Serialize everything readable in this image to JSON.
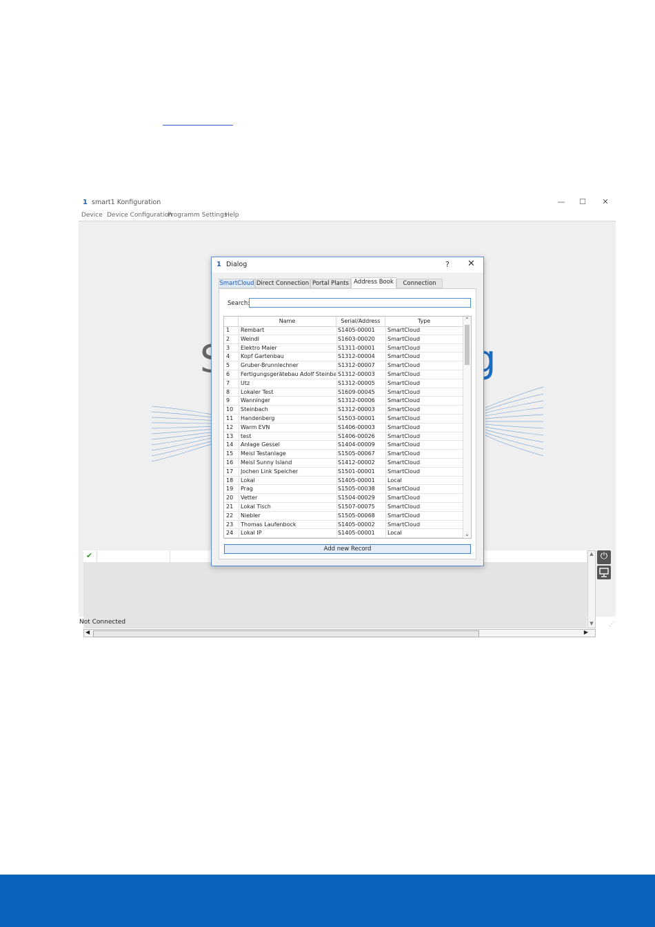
{
  "app": {
    "title": "smart1 Konfiguration",
    "logo_text": "1",
    "window_controls": {
      "minimize": "—",
      "maximize": "☐",
      "close": "✕"
    },
    "menu": [
      "Device",
      "Device Configuration",
      "Programm Settings",
      "Help"
    ],
    "status": "Not Connected",
    "background_fragments": {
      "left": "S",
      "right": "g"
    }
  },
  "dialog": {
    "title": "Dialog",
    "logo_text": "1",
    "help": "?",
    "close": "✕",
    "tabs": [
      "SmartCloud",
      "Direct Connection",
      "Portal Plants",
      "Address Book",
      "Connection Log"
    ],
    "selected_tab": "Address Book",
    "search": {
      "label": "Search:",
      "value": ""
    },
    "columns": [
      "Name",
      "Serial/Address",
      "Type"
    ],
    "rows": [
      {
        "n": "1",
        "name": "Rembart",
        "serial": "S1405-00001",
        "type": "SmartCloud"
      },
      {
        "n": "2",
        "name": "Weindl",
        "serial": "S1603-00020",
        "type": "SmartCloud"
      },
      {
        "n": "3",
        "name": "Elektro Maier",
        "serial": "S1311-00001",
        "type": "SmartCloud"
      },
      {
        "n": "4",
        "name": "Kopf Gartenbau",
        "serial": "S1312-00004",
        "type": "SmartCloud"
      },
      {
        "n": "5",
        "name": "Gruber-Brunnlechner",
        "serial": "S1312-00007",
        "type": "SmartCloud"
      },
      {
        "n": "6",
        "name": "Fertigungsgerätebau Adolf Steinba...",
        "serial": "S1312-00003",
        "type": "SmartCloud"
      },
      {
        "n": "7",
        "name": "Utz",
        "serial": "S1312-00005",
        "type": "SmartCloud"
      },
      {
        "n": "8",
        "name": "Lokaler Test",
        "serial": "S1609-00045",
        "type": "SmartCloud"
      },
      {
        "n": "9",
        "name": "Wanninger",
        "serial": "S1312-00006",
        "type": "SmartCloud"
      },
      {
        "n": "10",
        "name": "Steinbach",
        "serial": "S1312-00003",
        "type": "SmartCloud"
      },
      {
        "n": "11",
        "name": "Handenberg",
        "serial": "S1503-00001",
        "type": "SmartCloud"
      },
      {
        "n": "12",
        "name": "Warm EVN",
        "serial": "S1406-00003",
        "type": "SmartCloud"
      },
      {
        "n": "13",
        "name": "test",
        "serial": "S1406-00026",
        "type": "SmartCloud"
      },
      {
        "n": "14",
        "name": "Anlage Gessel",
        "serial": "S1404-00009",
        "type": "SmartCloud"
      },
      {
        "n": "15",
        "name": "Meisl Testanlage",
        "serial": "S1505-00067",
        "type": "SmartCloud"
      },
      {
        "n": "16",
        "name": "Meisl Sunny Island",
        "serial": "S1412-00002",
        "type": "SmartCloud"
      },
      {
        "n": "17",
        "name": "Jochen Link Speicher",
        "serial": "S1501-00001",
        "type": "SmartCloud"
      },
      {
        "n": "18",
        "name": "Lokal",
        "serial": "S1405-00001",
        "type": "Local"
      },
      {
        "n": "19",
        "name": "Prag",
        "serial": "S1505-00038",
        "type": "SmartCloud"
      },
      {
        "n": "20",
        "name": "Vetter",
        "serial": "S1504-00029",
        "type": "SmartCloud"
      },
      {
        "n": "21",
        "name": "Lokal Tisch",
        "serial": "S1507-00075",
        "type": "SmartCloud"
      },
      {
        "n": "22",
        "name": "Niebler",
        "serial": "S1505-00068",
        "type": "SmartCloud"
      },
      {
        "n": "23",
        "name": "Thomas Laufenbock",
        "serial": "S1405-00002",
        "type": "SmartCloud"
      },
      {
        "n": "24",
        "name": "Lokal IP",
        "serial": "S1405-00001",
        "type": "Local"
      }
    ],
    "add_button": "Add new Record"
  },
  "colors": {
    "accent": "#0a64bd",
    "dialog_border": "#5b8fd6",
    "check": "#2e9e2e"
  },
  "icons": [
    "check-icon",
    "power-icon",
    "monitor-icon",
    "scroll-up-icon",
    "scroll-down-icon",
    "scroll-left-icon",
    "scroll-right-icon"
  ]
}
